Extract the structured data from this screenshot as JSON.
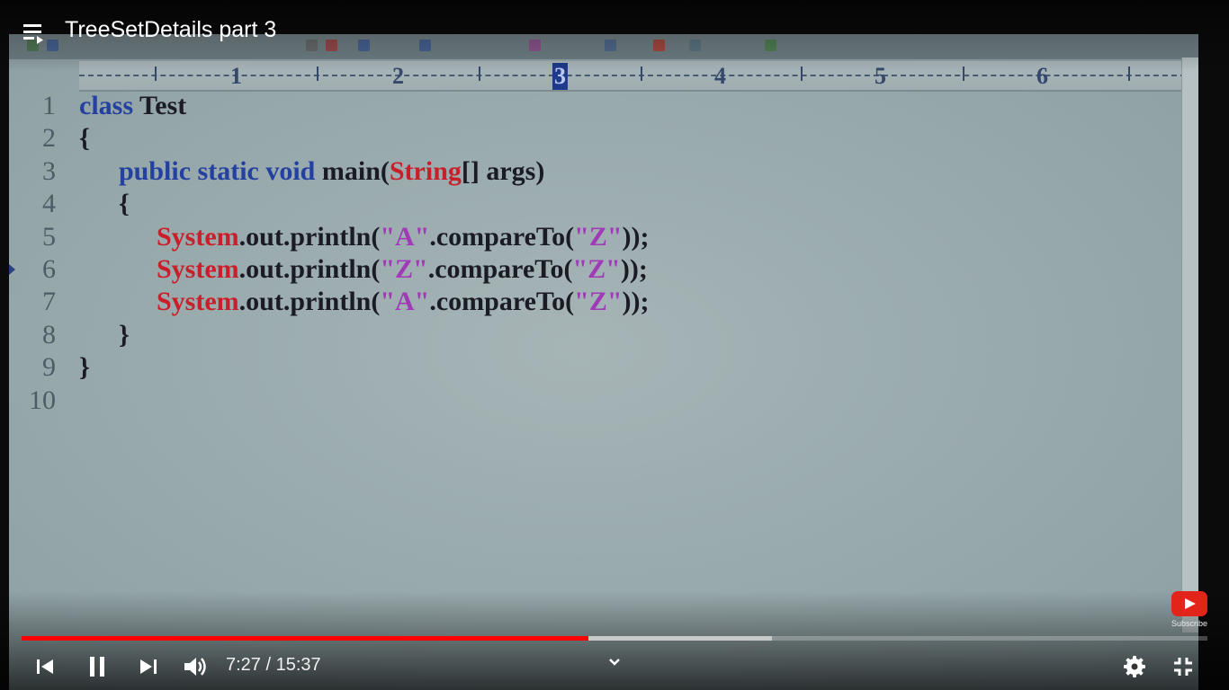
{
  "video": {
    "title": "TreeSetDetails part 3",
    "current_time": "7:27",
    "separator": "/",
    "duration": "15:37",
    "played_fraction": 0.478,
    "buffered_fraction": 0.633
  },
  "ruler": {
    "numbers": [
      "1",
      "2",
      "3",
      "4",
      "5",
      "6"
    ],
    "selected": "3"
  },
  "code_lines": [
    {
      "n": "1",
      "tokens": [
        {
          "t": "class",
          "c": "kw"
        },
        {
          "t": " Test",
          "c": "plain"
        }
      ]
    },
    {
      "n": "2",
      "tokens": [
        {
          "t": "{",
          "c": "plain"
        }
      ]
    },
    {
      "n": "3",
      "tokens": [
        {
          "t": "public static void",
          "c": "kw"
        },
        {
          "t": " main(",
          "c": "plain"
        },
        {
          "t": "String",
          "c": "cls"
        },
        {
          "t": "[] args)",
          "c": "plain"
        }
      ]
    },
    {
      "n": "4",
      "tokens": [
        {
          "t": "{",
          "c": "plain"
        }
      ]
    },
    {
      "n": "5",
      "tokens": [
        {
          "t": "System",
          "c": "cls"
        },
        {
          "t": ".out.println(",
          "c": "plain"
        },
        {
          "t": "\"A\"",
          "c": "str"
        },
        {
          "t": ".compareTo(",
          "c": "plain"
        },
        {
          "t": "\"Z\"",
          "c": "str"
        },
        {
          "t": "));",
          "c": "plain"
        }
      ]
    },
    {
      "n": "6",
      "tokens": [
        {
          "t": "System",
          "c": "cls"
        },
        {
          "t": ".out.println(",
          "c": "plain"
        },
        {
          "t": "\"Z\"",
          "c": "str"
        },
        {
          "t": ".compareTo(",
          "c": "plain"
        },
        {
          "t": "\"Z\"",
          "c": "str"
        },
        {
          "t": "));",
          "c": "plain"
        }
      ]
    },
    {
      "n": "7",
      "tokens": [
        {
          "t": "System",
          "c": "cls"
        },
        {
          "t": ".out.println(",
          "c": "plain"
        },
        {
          "t": "\"A\"",
          "c": "str"
        },
        {
          "t": ".compareTo(",
          "c": "plain"
        },
        {
          "t": "\"Z\"",
          "c": "str"
        },
        {
          "t": "));",
          "c": "plain"
        }
      ]
    },
    {
      "n": "8",
      "tokens": [
        {
          "t": "}",
          "c": "plain"
        }
      ]
    },
    {
      "n": "9",
      "tokens": [
        {
          "t": "}",
          "c": "plain"
        }
      ]
    },
    {
      "n": "10",
      "tokens": []
    }
  ],
  "subscribe": {
    "label": "Subscribe"
  },
  "controls": {
    "icons": [
      "playlist-icon",
      "previous-icon",
      "pause-icon",
      "next-icon",
      "volume-icon",
      "chevron-down-icon",
      "settings-icon",
      "exit-fullscreen-icon"
    ]
  },
  "colors": {
    "progress_played": "#ff0000",
    "keyword": "#2440a0",
    "class": "#c8202a",
    "string": "#a03ab8"
  }
}
